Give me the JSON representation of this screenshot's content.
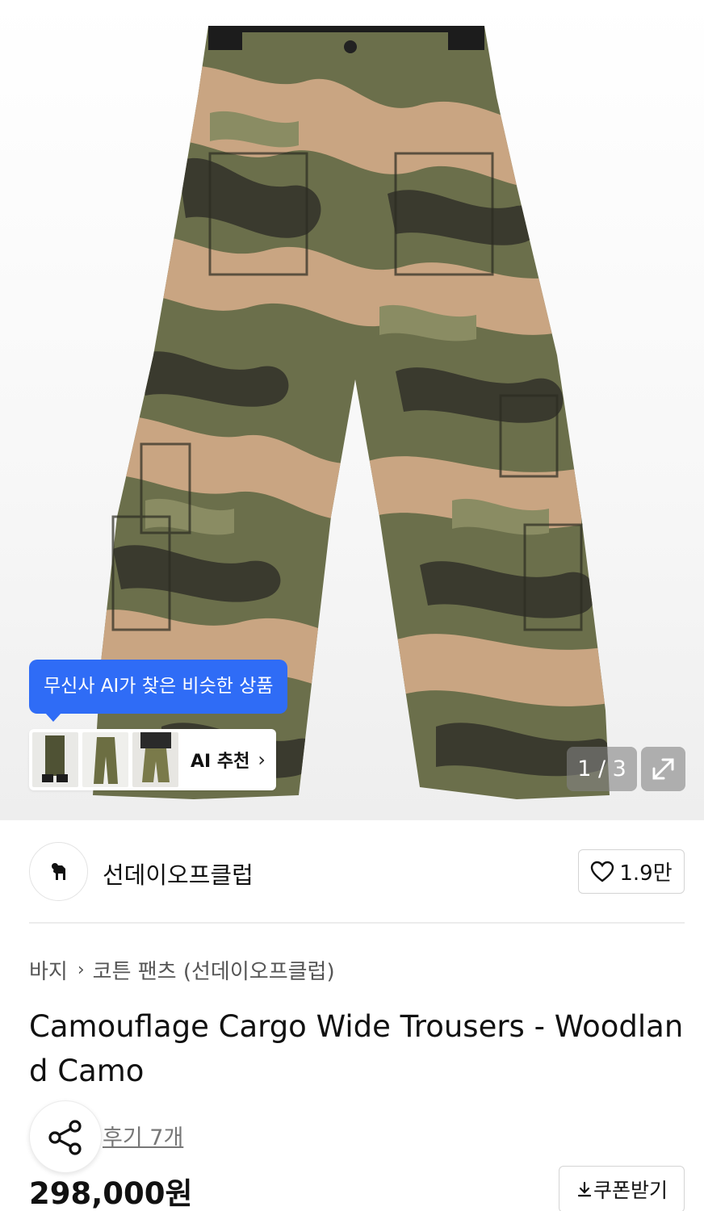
{
  "product_image": {
    "counter": "1 / 3",
    "ai_tooltip": "무신사 AI가 찾은 비슷한 상품",
    "ai_recommend_label": "AI 추천",
    "thumbnails": [
      "thumbnail-1",
      "thumbnail-2",
      "thumbnail-3"
    ]
  },
  "brand": {
    "name": "선데이오프클럽",
    "like_count": "1.9만"
  },
  "breadcrumb": {
    "category": "바지",
    "subcategory": "코튼 팬츠 (선데이오프클럽)"
  },
  "product": {
    "title": "Camouflage Cargo Wide Trousers - Woodland Camo",
    "review_link": "후기 7개",
    "price": "298,000원",
    "coupon_label": "쿠폰받기"
  },
  "colors": {
    "accent": "#2f6cf6",
    "camo_light": "#c9a582",
    "camo_mid": "#6b6f4b",
    "camo_dark": "#3a3a2e"
  }
}
